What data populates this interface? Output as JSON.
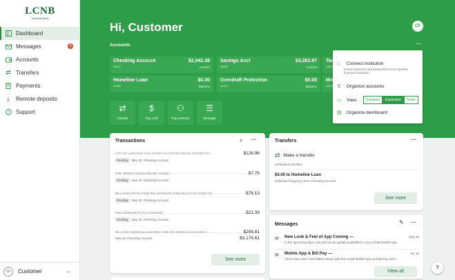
{
  "brand": {
    "name": "LCNB",
    "tagline": "National Bank"
  },
  "nav": {
    "items": [
      {
        "label": "Dashboard",
        "icon": "dashboard-icon",
        "active": true
      },
      {
        "label": "Messages",
        "icon": "envelope-icon",
        "badge": "2"
      },
      {
        "label": "Accounts",
        "icon": "wallet-icon"
      },
      {
        "label": "Transfers",
        "icon": "transfer-icon"
      },
      {
        "label": "Payments",
        "icon": "receipt-icon"
      },
      {
        "label": "Remote deposits",
        "icon": "deposit-icon"
      },
      {
        "label": "Support",
        "icon": "help-circle-icon"
      }
    ]
  },
  "user": {
    "initials": "CF",
    "name": "Customer"
  },
  "header": {
    "greeting": "Hi, Customer",
    "avatar_initials": "CF"
  },
  "accounts": {
    "title": "Accounts",
    "more": "···",
    "cards": [
      {
        "name": "Checking Account",
        "number": "x0110",
        "amount": "$2,942.38",
        "sub": "Current"
      },
      {
        "name": "Savings Acct",
        "number": "x0000",
        "amount": "$3,263.97",
        "sub": "Current"
      },
      {
        "name": "Tax",
        "number": "x0000",
        "amount": "",
        "sub": ""
      },
      {
        "name": "Homeline Loan",
        "number": "x7000",
        "amount": "$0.00",
        "sub": "Balance"
      },
      {
        "name": "Overdraft Protection",
        "number": "x0110",
        "amount": "$0.00",
        "sub": "Balance"
      },
      {
        "name": "Mo",
        "number": "x0000",
        "amount": "",
        "sub": ""
      }
    ]
  },
  "quick_actions": [
    {
      "label": "Transfer",
      "icon": "transfer-icon",
      "glyph": "⇄"
    },
    {
      "label": "Pay a bill",
      "icon": "bill-icon",
      "glyph": "$"
    },
    {
      "label": "Pay a person",
      "icon": "person-icon",
      "glyph": "⚇"
    },
    {
      "label": "Message",
      "icon": "chat-icon",
      "glyph": "☰"
    }
  ],
  "dropdown": {
    "connect": "Connect institution",
    "connect_sub": "Check balances and transactions from another financial institution.",
    "organize_accounts": "Organize accounts",
    "view_label": "View",
    "view_options": [
      "Compact",
      "Expanded",
      "Totals"
    ],
    "view_selected": "Expanded",
    "organize_dashboard": "Organize dashboard"
  },
  "transactions": {
    "title": "Transactions",
    "rows": [
      {
        "desc": "CITY OF LEBANON UTIL PAYMT ACH ENTRY MEMO POSTED TO...",
        "amount": "$126.96",
        "pending": "Pending",
        "meta": "May 20, Checking Account"
      },
      {
        "desc": "PRE JERSEY MIKES ONLINE 721082",
        "amount": "$7.75",
        "pending": "Pending",
        "meta": "May 20, Checking Account"
      },
      {
        "desc": "BILL PAID STATE FARM INS AUTO/LIFE FIRE HEALTH PA CONF #5...",
        "amount": "$76.13",
        "pending": "Pending",
        "meta": "May 20, Checking Account"
      },
      {
        "desc": "PRE AMZN MKTP US 273829400",
        "amount": "$21.39",
        "pending": "Pending",
        "meta": "May 16, Checking Account"
      },
      {
        "desc": "BILL PAID GENERAL ELECTRIC CRE DIT UNION LOAN CONF #...",
        "amount": "$294.81",
        "amount2": "$3,174.61",
        "pending": "",
        "meta": "May 19, Checking Account"
      }
    ],
    "see_more": "See more"
  },
  "transfers": {
    "title": "Transfers",
    "make": "Make a transfer",
    "scheduled_label": "Scheduled transfers",
    "scheduled_title": "$0.00 to Homeline Loan",
    "scheduled_sub": "Unknown frequency, from Checking Account",
    "see_more": "See more"
  },
  "messages": {
    "title": "Messages",
    "rows": [
      {
        "title": "New Look & Feel of App Coming —",
        "date": "May 15",
        "body": "In the upcoming days, you will see an update available for your LCNB Mobile App..."
      },
      {
        "title": "Mobile App & Bill Pay —",
        "date": "Apr 16",
        "body": "There have been intermittent issues with the LCNB Mobile App and Bill Pay due t..."
      }
    ],
    "view_all": "View all"
  },
  "help": "?"
}
